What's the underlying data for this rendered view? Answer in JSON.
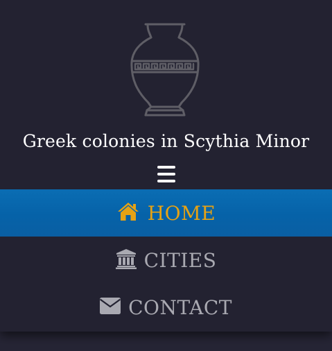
{
  "site": {
    "title": "Greek colonies in Scythia Minor",
    "logo_icon": "greek-amphora-icon"
  },
  "menu_toggle": {
    "icon": "hamburger-menu-icon"
  },
  "nav": {
    "items": [
      {
        "label": "HOME",
        "icon": "home-icon",
        "active": true
      },
      {
        "label": "CITIES",
        "icon": "temple-icon",
        "active": false
      },
      {
        "label": "CONTACT",
        "icon": "envelope-icon",
        "active": false
      }
    ]
  },
  "colors": {
    "background": "#232231",
    "active_bg": "#0866ad",
    "active_text": "#e6a214",
    "inactive_text": "#a9a9b1",
    "title_text": "#ffffff"
  }
}
